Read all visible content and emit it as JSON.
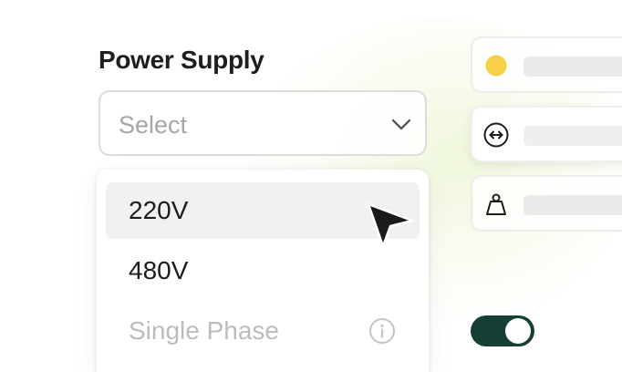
{
  "field": {
    "label": "Power Supply",
    "placeholder": "Select"
  },
  "dropdown": {
    "options": [
      {
        "label": "220V",
        "state": "hover"
      },
      {
        "label": "480V",
        "state": "default"
      },
      {
        "label": "Single Phase",
        "state": "disabled",
        "icon": "info-icon"
      }
    ]
  },
  "side_cards": [
    {
      "icon": "dot-icon",
      "icon_color": "#f5d24a"
    },
    {
      "icon": "horizontal-arrows-icon"
    },
    {
      "icon": "weight-icon"
    }
  ],
  "toggle": {
    "on": true,
    "color": "#153f35"
  },
  "colors": {
    "accent_dark_green": "#153f35",
    "dot_yellow": "#f5d24a",
    "hover_bg": "#f2f1f2"
  }
}
